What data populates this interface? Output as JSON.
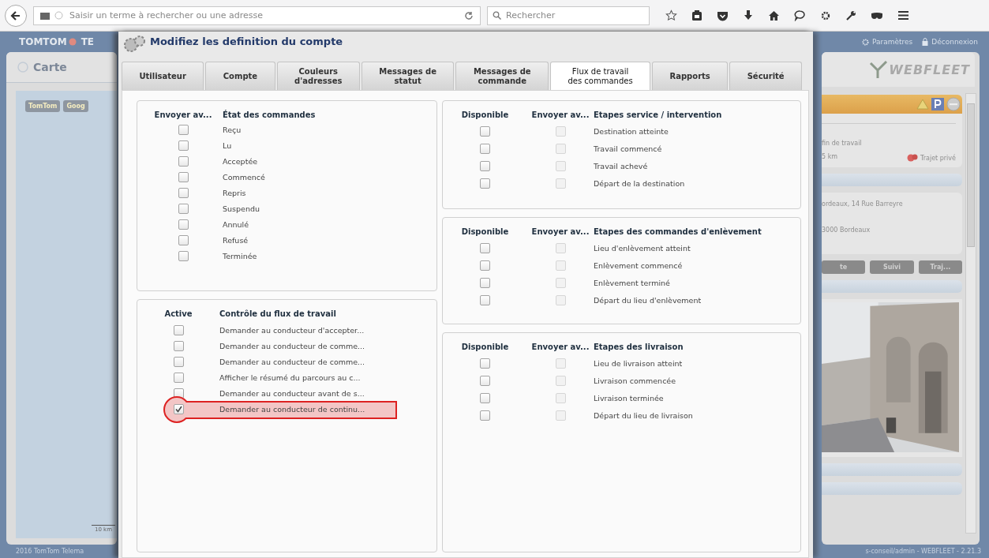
{
  "browser": {
    "address_placeholder": "Saisir un terme à rechercher ou une adresse",
    "search_placeholder": "Rechercher"
  },
  "app": {
    "brand": "TOMTOM",
    "brand_suffix": "TE",
    "top_links": [
      "Paramètres",
      "Déconnexion"
    ],
    "map_panel": {
      "title": "Carte",
      "map_buttons": [
        "TomTom",
        "Goog"
      ],
      "scale": "10 km"
    },
    "logo": "WEBFLEET",
    "vehicle": {
      "line_1": "fin de travail",
      "distance": "5 km",
      "trip_type": "Trajet privé",
      "address_1": "ordeaux, 14 Rue Barreyre",
      "address_2": "3000 Bordeaux",
      "buttons": [
        "te",
        "Suivi",
        "Traj..."
      ]
    },
    "footer_left": "2016 TomTom Telema",
    "footer_right": "s-conseil/admin - WEBFLEET - 2.21.3"
  },
  "dialog": {
    "title": "Modifiez les definition du compte",
    "tabs": [
      {
        "label": "Utilisateur",
        "selected": false
      },
      {
        "label": "Compte",
        "selected": false
      },
      {
        "label": "Couleurs\nd'adresses",
        "selected": false
      },
      {
        "label": "Messages de\nstatut",
        "selected": false
      },
      {
        "label": "Messages de\ncommande",
        "selected": false
      },
      {
        "label": "Flux de travail\ndes commandes",
        "selected": true
      },
      {
        "label": "Rapports",
        "selected": false
      },
      {
        "label": "Sécurité",
        "selected": false
      }
    ],
    "order_states": {
      "headers": [
        "Envoyer av...",
        "État des commandes"
      ],
      "rows": [
        {
          "label": "Reçu",
          "checked": false
        },
        {
          "label": "Lu",
          "checked": false
        },
        {
          "label": "Acceptée",
          "checked": false
        },
        {
          "label": "Commencé",
          "checked": false
        },
        {
          "label": "Repris",
          "checked": false
        },
        {
          "label": "Suspendu",
          "checked": false
        },
        {
          "label": "Annulé",
          "checked": false
        },
        {
          "label": "Refusé",
          "checked": false
        },
        {
          "label": "Terminée",
          "checked": false
        }
      ]
    },
    "workflow": {
      "headers": [
        "Active",
        "Contrôle du flux de travail"
      ],
      "rows": [
        {
          "label": "Demander au conducteur d'accepter...",
          "checked": false,
          "highlighted": false
        },
        {
          "label": "Demander au conducteur de comme...",
          "checked": false,
          "highlighted": false
        },
        {
          "label": "Demander au conducteur de comme...",
          "checked": false,
          "highlighted": false
        },
        {
          "label": "Afficher le résumé du parcours au c...",
          "checked": false,
          "highlighted": false
        },
        {
          "label": "Demander au conducteur avant de s...",
          "checked": false,
          "highlighted": false
        },
        {
          "label": "Demander au conducteur de continu...",
          "checked": true,
          "highlighted": true
        }
      ]
    },
    "stage_sections": [
      {
        "headers": [
          "Disponible",
          "Envoyer av...",
          "Etapes service / intervention"
        ],
        "send_enabled": false,
        "rows": [
          {
            "label": "Destination atteinte",
            "available": false,
            "send": false
          },
          {
            "label": "Travail commencé",
            "available": false,
            "send": false
          },
          {
            "label": "Travail achevé",
            "available": false,
            "send": false
          },
          {
            "label": "Départ de la destination",
            "available": false,
            "send": false
          }
        ]
      },
      {
        "headers": [
          "Disponible",
          "Envoyer av...",
          "Etapes des commandes d'enlèvement"
        ],
        "send_enabled": false,
        "rows": [
          {
            "label": "Lieu d'enlèvement atteint",
            "available": false,
            "send": false
          },
          {
            "label": "Enlèvement commencé",
            "available": false,
            "send": false
          },
          {
            "label": "Enlèvement terminé",
            "available": false,
            "send": false
          },
          {
            "label": "Départ du lieu d'enlèvement",
            "available": false,
            "send": false
          }
        ]
      },
      {
        "headers": [
          "Disponible",
          "Envoyer av...",
          "Etapes des livraison"
        ],
        "send_enabled": false,
        "rows": [
          {
            "label": "Lieu de livraison atteint",
            "available": false,
            "send": false
          },
          {
            "label": "Livraison commencée",
            "available": false,
            "send": false
          },
          {
            "label": "Livraison terminée",
            "available": false,
            "send": false
          },
          {
            "label": "Départ du lieu de livraison",
            "available": false,
            "send": false
          }
        ]
      }
    ]
  }
}
